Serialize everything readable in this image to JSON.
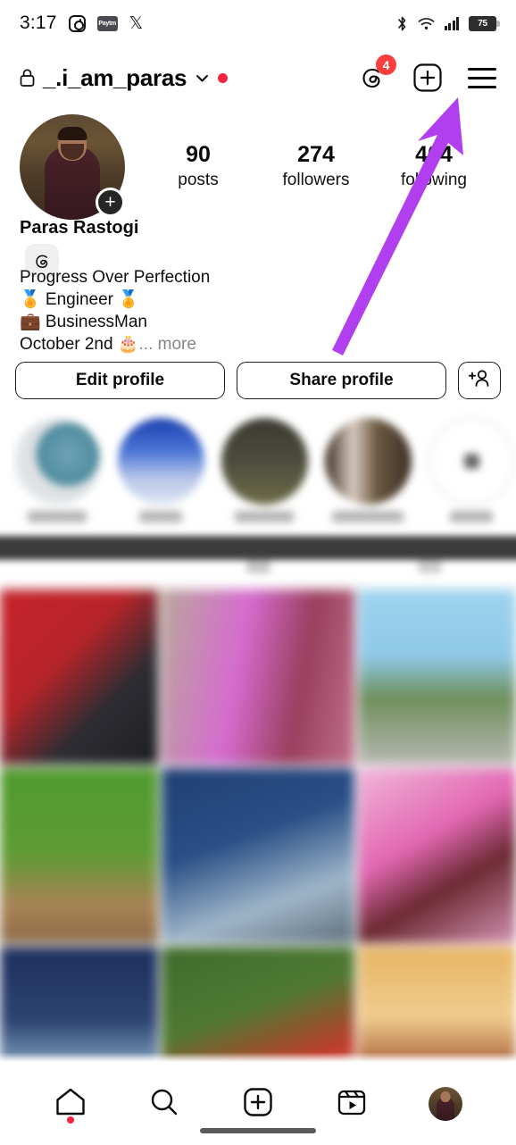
{
  "status_bar": {
    "time": "3:17",
    "left_icons": [
      "instagram-icon",
      "paytm-icon",
      "x-icon"
    ],
    "paytm_label": "Paytm",
    "right_icons": [
      "bluetooth-icon",
      "wifi-icon",
      "cellular-signal-icon"
    ],
    "battery_percent": "75"
  },
  "header": {
    "lock_icon": "lock-icon",
    "username": "_.i_am_paras",
    "chevron_icon": "chevron-down-icon",
    "has_red_dot": true,
    "threads_icon": "threads-icon",
    "threads_badge_count": "4",
    "create_icon": "plus-box-icon",
    "menu_icon": "hamburger-menu-icon"
  },
  "profile": {
    "avatar_name": "profile-avatar",
    "add_story_label": "+",
    "display_name": "Paras Rastogi",
    "stats": [
      {
        "value": "90",
        "label": "posts"
      },
      {
        "value": "274",
        "label": "followers"
      },
      {
        "value": "404",
        "label": "following"
      }
    ]
  },
  "bio": {
    "threads_chip_icon": "threads-icon",
    "line1": "Progress Over Perfection",
    "line2": "🏅 Engineer 🏅",
    "line3": "💼 BusinessMan",
    "line4": "October 2nd 🎂",
    "more_label": "... more"
  },
  "action_buttons": {
    "edit_profile": "Edit profile",
    "share_profile": "Share profile",
    "add_person_icon": "add-person-icon"
  },
  "highlights": [
    {
      "name": "highlight-1",
      "label_blurred": true
    },
    {
      "name": "highlight-2",
      "label_blurred": true
    },
    {
      "name": "highlight-3",
      "label_blurred": true
    },
    {
      "name": "highlight-4",
      "label_blurred": true
    },
    {
      "name": "highlight-new",
      "label_blurred": true
    }
  ],
  "tabs": [
    {
      "icon": "grid-tab-icon",
      "active": true
    },
    {
      "icon": "reels-tab-icon",
      "active": false
    },
    {
      "icon": "tagged-tab-icon",
      "active": false
    }
  ],
  "grid_posts": [
    {
      "name": "post-thumbnail",
      "c1": "#b8232a",
      "c2": "#2d2d33"
    },
    {
      "name": "post-thumbnail",
      "c1": "#cf7bd0",
      "c2": "#8f4a55"
    },
    {
      "name": "post-thumbnail",
      "c1": "#8fc9e8",
      "c2": "#6e8f5c"
    },
    {
      "name": "post-thumbnail",
      "c1": "#5e9b34",
      "c2": "#8d6a45"
    },
    {
      "name": "post-thumbnail",
      "c1": "#2a4f86",
      "c2": "#9fb6c9"
    },
    {
      "name": "post-thumbnail",
      "c1": "#e267b2",
      "c2": "#e9a8cc"
    },
    {
      "name": "post-thumbnail",
      "c1": "#1d2f5c",
      "c2": "#9fc4d8"
    },
    {
      "name": "post-thumbnail",
      "c1": "#3f6b2c",
      "c2": "#c23a2a"
    },
    {
      "name": "post-thumbnail",
      "c1": "#e7b463",
      "c2": "#7a3c24"
    }
  ],
  "bottom_nav": [
    {
      "name": "nav-home",
      "icon": "home-icon",
      "has_dot": true
    },
    {
      "name": "nav-search",
      "icon": "search-icon",
      "has_dot": false
    },
    {
      "name": "nav-create",
      "icon": "plus-box-icon",
      "has_dot": false
    },
    {
      "name": "nav-reels",
      "icon": "reels-icon",
      "has_dot": false
    },
    {
      "name": "nav-profile",
      "icon": "profile-avatar-icon",
      "has_dot": false
    }
  ],
  "annotation": {
    "arrow_color": "#b13ff0",
    "points_to": "hamburger-menu-icon"
  }
}
